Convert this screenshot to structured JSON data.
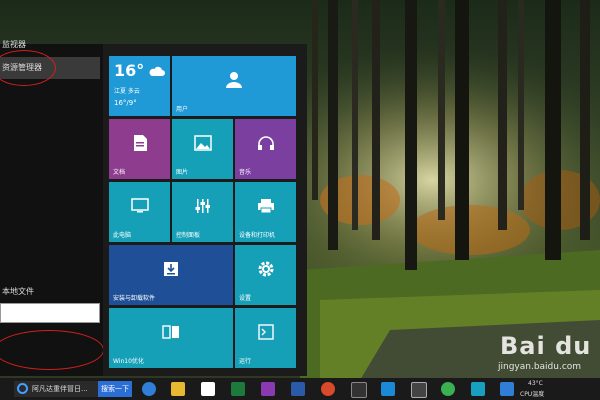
{
  "start_menu": {
    "left_items": {
      "monitor_label": "监视器",
      "explorer_label": "资源管理器",
      "file_label": "本地文件"
    }
  },
  "tiles": {
    "weather": {
      "temp": "16°",
      "location": "江夏  多云",
      "range": "16°/9°"
    },
    "user": {
      "label": "用户",
      "icon": "user-icon"
    },
    "docs": {
      "label": "文档",
      "icon": "document-icon"
    },
    "pics": {
      "label": "图片",
      "icon": "picture-icon"
    },
    "music": {
      "label": "音乐",
      "icon": "headphones-icon"
    },
    "pc": {
      "label": "此电脑",
      "icon": "monitor-icon"
    },
    "ctrl": {
      "label": "控制面板",
      "icon": "sliders-icon"
    },
    "print": {
      "label": "设备和打印机",
      "icon": "printer-icon"
    },
    "install": {
      "label": "安装与卸载软件",
      "icon": "install-icon"
    },
    "settings": {
      "label": "设置",
      "icon": "gear-icon"
    },
    "win10": {
      "label": "Win10优化",
      "icon": "optimize-icon"
    },
    "run": {
      "label": "运行",
      "icon": "run-icon"
    }
  },
  "taskbar": {
    "browser_label": "阿凡达重伴冒日...",
    "search_btn": "搜索一下",
    "tray_temp": "43°C",
    "tray_cpu": "CPU温度"
  },
  "watermark": {
    "logo": "Bai du",
    "url": "jingyan.baidu.com"
  },
  "colors": {
    "tile_blue": "#1f9ad6",
    "tile_teal": "#16a0b8",
    "tile_purple": "#8e3d8e",
    "tile_violet": "#7b3fa0",
    "tile_navy": "#1f4f96",
    "highlight_red": "#d02020"
  }
}
